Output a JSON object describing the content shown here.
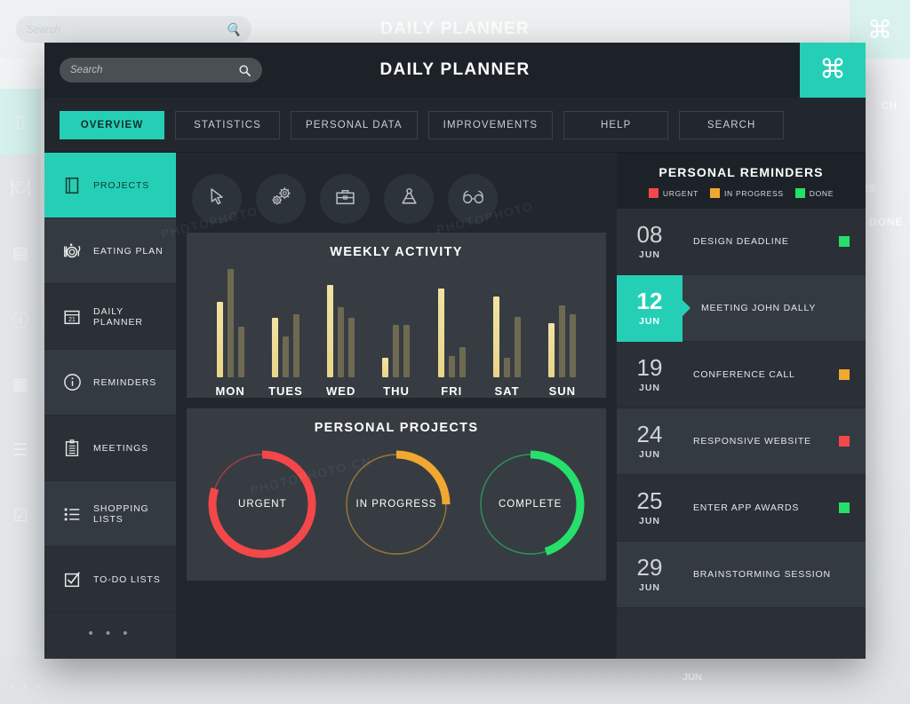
{
  "window": {
    "title": "DAILY PLANNER",
    "command_icon": "⌘"
  },
  "search": {
    "value": "",
    "placeholder": "Search",
    "icon": "search-icon"
  },
  "tabs": [
    {
      "label": "OVERVIEW",
      "active": true
    },
    {
      "label": "STATISTICS",
      "active": false
    },
    {
      "label": "PERSONAL DATA",
      "active": false
    },
    {
      "label": "IMPROVEMENTS",
      "active": false
    },
    {
      "label": "HELP",
      "active": false
    },
    {
      "label": "SEARCH",
      "active": false
    }
  ],
  "sidebar": {
    "items": [
      {
        "label": "PROJECTS",
        "icon": "book-icon",
        "active": true
      },
      {
        "label": "EATING PLAN",
        "icon": "cutlery-icon",
        "active": false
      },
      {
        "label": "DAILY PLANNER",
        "icon": "calendar-icon",
        "active": false
      },
      {
        "label": "REMINDERS",
        "icon": "info-icon",
        "active": false
      },
      {
        "label": "MEETINGS",
        "icon": "clipboard-icon",
        "active": false
      },
      {
        "label": "SHOPPING LISTS",
        "icon": "list-icon",
        "active": false
      },
      {
        "label": "TO-DO LISTS",
        "icon": "checkbox-icon",
        "active": false
      }
    ],
    "more_label": "• • •"
  },
  "toolbar": {
    "items": [
      {
        "icon": "cursor-icon"
      },
      {
        "icon": "gears-icon"
      },
      {
        "icon": "briefcase-icon"
      },
      {
        "icon": "compass-icon"
      },
      {
        "icon": "glasses-icon"
      }
    ]
  },
  "reminders": {
    "title": "PERSONAL REMINDERS",
    "legend": [
      {
        "label": "URGENT",
        "color": "#f4474a"
      },
      {
        "label": "IN PROGRESS",
        "color": "#f0a830"
      },
      {
        "label": "DONE",
        "color": "#25e06a"
      }
    ],
    "rows": [
      {
        "day": "08",
        "month": "JUN",
        "text": "DESIGN DEADLINE",
        "status": "#25e06a",
        "active": false
      },
      {
        "day": "12",
        "month": "JUN",
        "text": "MEETING JOHN DALLY",
        "status": "",
        "active": true
      },
      {
        "day": "19",
        "month": "JUN",
        "text": "CONFERENCE CALL",
        "status": "#f0a830",
        "active": false
      },
      {
        "day": "24",
        "month": "JUN",
        "text": "RESPONSIVE WEBSITE",
        "status": "#f4474a",
        "active": false
      },
      {
        "day": "25",
        "month": "JUN",
        "text": "ENTER APP AWARDS",
        "status": "#25e06a",
        "active": false
      },
      {
        "day": "29",
        "month": "JUN",
        "text": "BRAINSTORMING SESSION",
        "status": "",
        "active": false
      }
    ]
  },
  "chart_data": [
    {
      "type": "bar",
      "title": "WEEKLY ACTIVITY",
      "xlabel": "",
      "ylabel": "",
      "ylim": [
        0,
        100
      ],
      "grid": false,
      "legend": "none",
      "categories": [
        "MON",
        "TUES",
        "WED",
        "THU",
        "FRI",
        "SAT",
        "SUN"
      ],
      "series": [
        {
          "name": "primary",
          "color": "#ecdc95",
          "values": [
            70,
            55,
            85,
            18,
            82,
            75,
            50
          ]
        },
        {
          "name": "secondary",
          "color": "#6e6a52",
          "values": [
            100,
            38,
            65,
            48,
            20,
            18,
            66
          ]
        },
        {
          "name": "tertiary",
          "color": "#6e6a52",
          "values": [
            47,
            58,
            55,
            48,
            28,
            56,
            58
          ]
        }
      ]
    },
    {
      "type": "pie",
      "title": "PERSONAL PROJECTS",
      "legend": "labels-inside",
      "slices": [
        {
          "label": "URGENT",
          "value": 80,
          "color": "#f4474a"
        },
        {
          "label": "IN PROGRESS",
          "value": 25,
          "color": "#f0a830"
        },
        {
          "label": "COMPLETE",
          "value": 45,
          "color": "#25e06a"
        }
      ]
    }
  ],
  "background_ghost": {
    "title": "DAILY PLANNER",
    "search_placeholder": "Search",
    "command_icon": "⌘",
    "partial_texts": [
      "CH",
      "RS",
      "DONE",
      "BRAINSTORMING SESSION",
      "JUN"
    ],
    "more_label": "• • •"
  },
  "colors": {
    "accent": "#25cfb6",
    "window_bg": "#22272e",
    "card_bg": "#373c42",
    "panel_bg": "#2b3037",
    "header_bg": "#1d2228"
  }
}
